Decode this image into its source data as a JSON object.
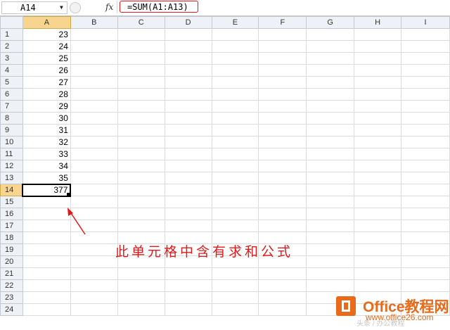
{
  "formula_bar": {
    "name_box": "A14",
    "fx_label": "fx",
    "formula": "=SUM(A1:A13)"
  },
  "sheet": {
    "columns": [
      "A",
      "B",
      "C",
      "D",
      "E",
      "F",
      "G",
      "H",
      "I"
    ],
    "rows": [
      "1",
      "2",
      "3",
      "4",
      "5",
      "6",
      "7",
      "8",
      "9",
      "10",
      "11",
      "12",
      "13",
      "14",
      "15",
      "16",
      "17",
      "18",
      "19",
      "20",
      "21",
      "22",
      "23",
      "24"
    ],
    "column_a_values": [
      "23",
      "24",
      "25",
      "26",
      "27",
      "28",
      "29",
      "30",
      "31",
      "32",
      "33",
      "34",
      "35",
      "377"
    ],
    "active_cell": "A14"
  },
  "annotation": {
    "text": "此单元格中含有求和公式"
  },
  "watermark": {
    "title": "Office教程网",
    "url": "www.office26.com",
    "credit": "头条 / 办公教程"
  },
  "colors": {
    "accent_red": "#e0191b",
    "selected_header": "#f8d58f",
    "watermark_orange": "#e86a1a"
  }
}
